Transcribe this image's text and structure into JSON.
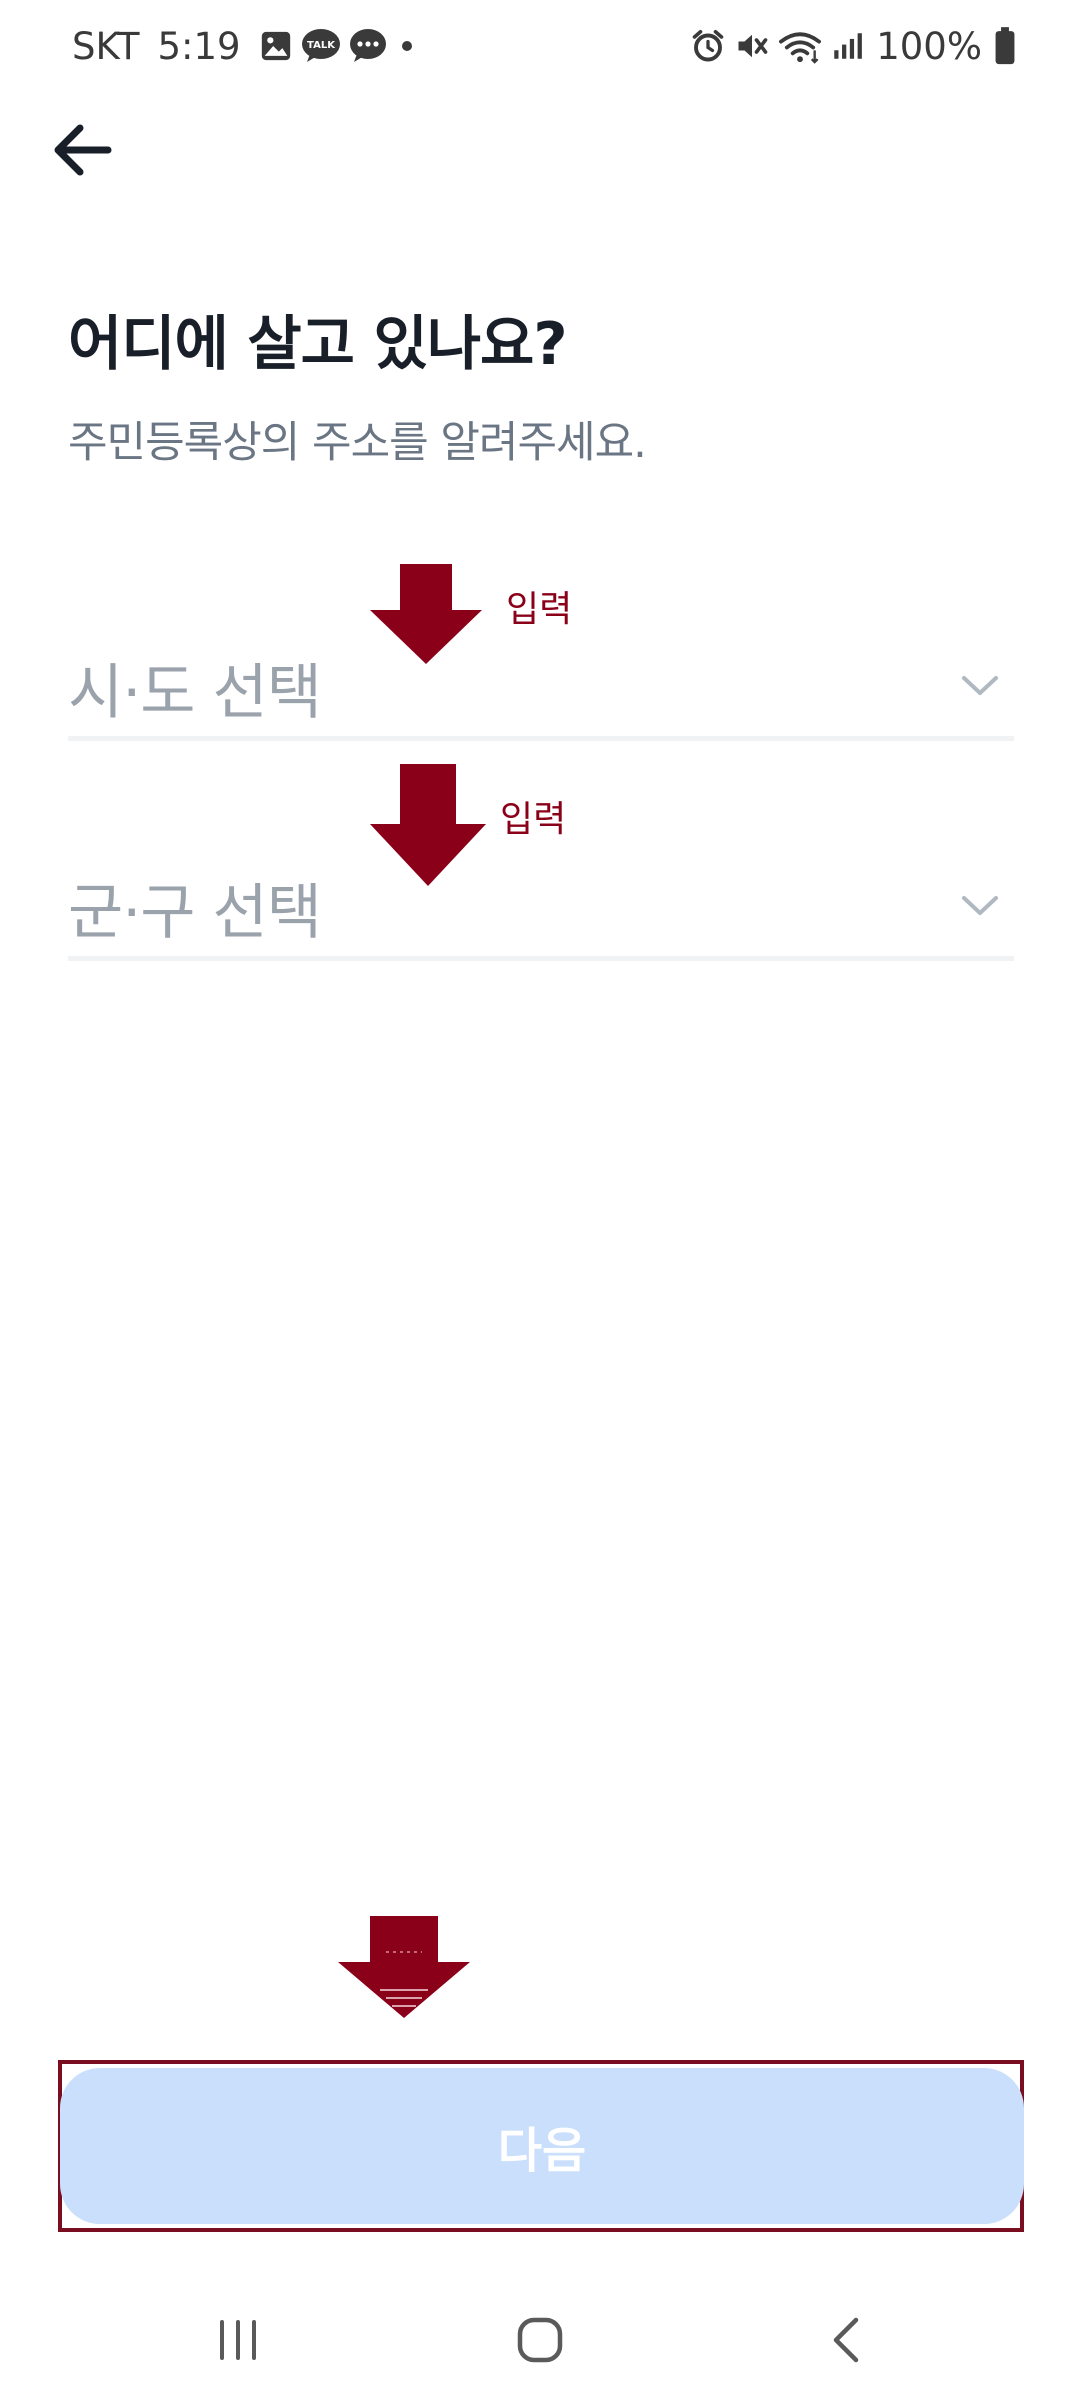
{
  "status_bar": {
    "carrier": "SKT",
    "time": "5:19",
    "left_icons": [
      "gallery-icon",
      "kakaotalk-icon",
      "chat-bubble-icon",
      "notification-dot-icon"
    ],
    "right_icons": [
      "alarm-icon",
      "mute-icon",
      "wifi-icon",
      "signal-icon",
      "battery-icon"
    ],
    "battery": "100%",
    "kakao_badge_text": "TALK"
  },
  "header": {
    "back_icon": "arrow-left-icon"
  },
  "page": {
    "title": "어디에 살고 있나요?",
    "subtitle": "주민등록상의 주소를 알려주세요."
  },
  "fields": {
    "sido": {
      "placeholder": "시·도 선택",
      "icon": "chevron-down-icon"
    },
    "gungu": {
      "placeholder": "군·구 선택",
      "icon": "chevron-down-icon"
    }
  },
  "annotations": {
    "sido_label": "입력",
    "gungu_label": "입력",
    "color": "#8b0019"
  },
  "footer": {
    "next_label": "다음",
    "next_bg": "#c9dffc"
  },
  "nav_bar": {
    "icons": [
      "recents-icon",
      "home-icon",
      "back-icon"
    ]
  }
}
